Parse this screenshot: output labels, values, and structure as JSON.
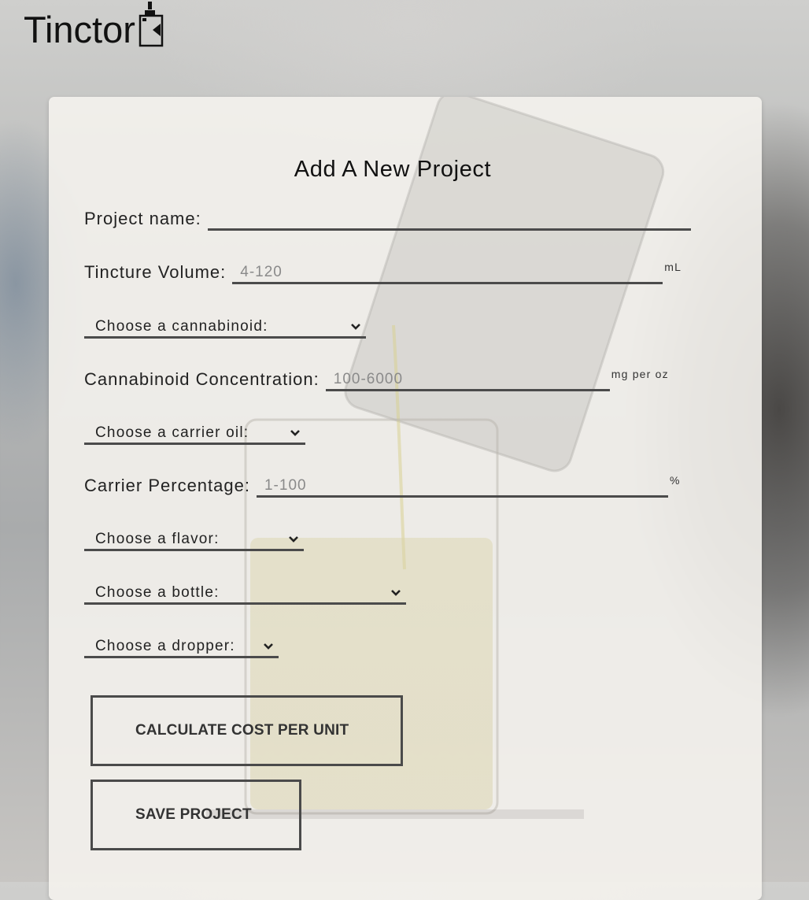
{
  "app": {
    "logo_text": "Tinctor"
  },
  "form": {
    "title": "Add A New Project",
    "project_name": {
      "label": "Project name:",
      "value": "",
      "placeholder": ""
    },
    "tincture_volume": {
      "label": "Tincture Volume:",
      "value": "",
      "placeholder": "4-120",
      "unit": "mL"
    },
    "cannabinoid_select": {
      "selected": "Choose a cannabinoid:",
      "icon": "chevron-down-icon"
    },
    "cannabinoid_concentration": {
      "label": "Cannabinoid Concentration:",
      "value": "",
      "placeholder": "100-6000",
      "unit": "mg per oz"
    },
    "carrier_oil_select": {
      "selected": "Choose a carrier oil:",
      "icon": "chevron-down-icon"
    },
    "carrier_percentage": {
      "label": "Carrier Percentage:",
      "value": "",
      "placeholder": "1-100",
      "unit": "%"
    },
    "flavor_select": {
      "selected": "Choose a flavor:",
      "icon": "chevron-down-icon"
    },
    "bottle_select": {
      "selected": "Choose a bottle:",
      "icon": "chevron-down-icon"
    },
    "dropper_select": {
      "selected": "Choose a dropper:",
      "icon": "chevron-down-icon"
    },
    "calculate_button_label": "CALCULATE COST PER UNIT",
    "save_button_label": "SAVE PROJECT"
  },
  "colors": {
    "card_background": "#f4f2ed",
    "input_underline": "#4b4b4b",
    "placeholder_text": "#8a8a8a",
    "button_border": "#4a4a4a"
  }
}
